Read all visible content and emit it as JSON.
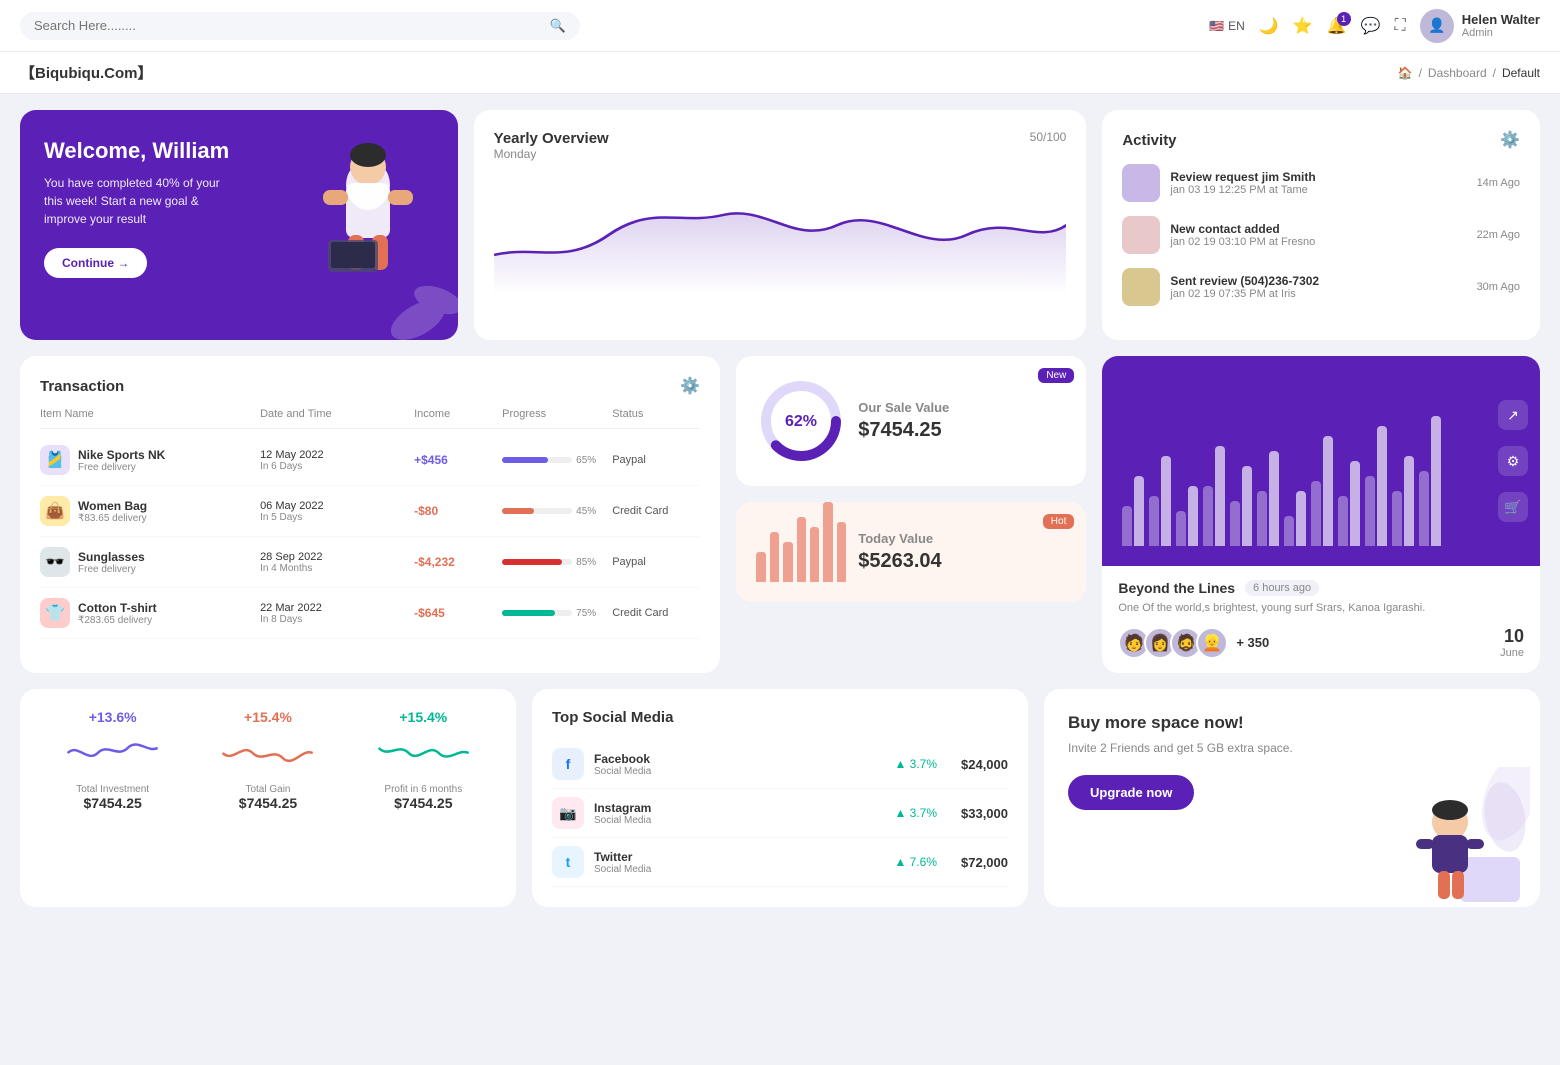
{
  "topnav": {
    "search_placeholder": "Search Here........",
    "lang": "EN",
    "notif_count": "1",
    "user_name": "Helen Walter",
    "user_role": "Admin"
  },
  "breadcrumb": {
    "site_title": "【Biqubiqu.Com】",
    "home": "🏠",
    "separator": "/",
    "dashboard": "Dashboard",
    "current": "Default"
  },
  "welcome": {
    "title": "Welcome, William",
    "subtitle": "You have completed 40% of your this week! Start a new goal & improve your result",
    "button": "Continue →"
  },
  "yearly_overview": {
    "title": "Yearly Overview",
    "day": "Monday",
    "score": "50/100"
  },
  "activity": {
    "title": "Activity",
    "items": [
      {
        "title": "Review request jim Smith",
        "sub": "jan 03 19 12:25 PM at Tame",
        "time": "14m Ago"
      },
      {
        "title": "New contact added",
        "sub": "jan 02 19 03:10 PM at Fresno",
        "time": "22m Ago"
      },
      {
        "title": "Sent review (504)236-7302",
        "sub": "jan 02 19 07:35 PM at Iris",
        "time": "30m Ago"
      }
    ]
  },
  "transaction": {
    "title": "Transaction",
    "headers": [
      "Item Name",
      "Date and Time",
      "Income",
      "Progress",
      "Status"
    ],
    "rows": [
      {
        "icon": "🎽",
        "icon_bg": "#e8e0f8",
        "name": "Nike Sports NK",
        "sub": "Free delivery",
        "date": "12 May 2022",
        "date_sub": "In 6 Days",
        "income": "+$456",
        "income_type": "pos",
        "progress": 65,
        "progress_color": "#6c5ce7",
        "status": "Paypal"
      },
      {
        "icon": "👜",
        "icon_bg": "#ffeaa7",
        "name": "Women Bag",
        "sub": "₹83.65 delivery",
        "date": "06 May 2022",
        "date_sub": "In 5 Days",
        "income": "-$80",
        "income_type": "neg",
        "progress": 45,
        "progress_color": "#e17055",
        "status": "Credit Card"
      },
      {
        "icon": "🕶️",
        "icon_bg": "#dfe6e9",
        "name": "Sunglasses",
        "sub": "Free delivery",
        "date": "28 Sep 2022",
        "date_sub": "In 4 Months",
        "income": "-$4,232",
        "income_type": "neg",
        "progress": 85,
        "progress_color": "#d63031",
        "status": "Paypal"
      },
      {
        "icon": "👕",
        "icon_bg": "#ffcccc",
        "name": "Cotton T-shirt",
        "sub": "₹283.65 delivery",
        "date": "22 Mar 2022",
        "date_sub": "In 8 Days",
        "income": "-$645",
        "income_type": "neg",
        "progress": 75,
        "progress_color": "#00b894",
        "status": "Credit Card"
      }
    ]
  },
  "sale_value": {
    "badge": "New",
    "percent": "62%",
    "label": "Our Sale Value",
    "value": "$7454.25"
  },
  "today_value": {
    "badge": "Hot",
    "label": "Today Value",
    "value": "$5263.04",
    "bars": [
      30,
      50,
      40,
      65,
      55,
      80,
      60
    ]
  },
  "beyond": {
    "title": "Beyond the Lines",
    "time": "6 hours ago",
    "desc": "One Of the world,s brightest, young surf Srars, Kanoa Igarashi.",
    "plus_count": "+ 350",
    "date_num": "10",
    "date_month": "June"
  },
  "stats": {
    "items": [
      {
        "percent": "+13.6%",
        "color": "#6c5ce7",
        "label": "Total Investment",
        "value": "$7454.25"
      },
      {
        "percent": "+15.4%",
        "color": "#e17055",
        "label": "Total Gain",
        "value": "$7454.25"
      },
      {
        "percent": "+15.4%",
        "color": "#00b894",
        "label": "Profit in 6 months",
        "value": "$7454.25"
      }
    ]
  },
  "social_media": {
    "title": "Top Social Media",
    "items": [
      {
        "icon": "f",
        "icon_bg": "#e8f0fe",
        "icon_color": "#1877f2",
        "name": "Facebook",
        "type": "Social Media",
        "growth": "3.7%",
        "amount": "$24,000"
      },
      {
        "icon": "📷",
        "icon_bg": "#ffe8f0",
        "icon_color": "#e1306c",
        "name": "Instagram",
        "type": "Social Media",
        "growth": "3.7%",
        "amount": "$33,000"
      },
      {
        "icon": "t",
        "icon_bg": "#e8f5fe",
        "icon_color": "#1da1f2",
        "name": "Twitter",
        "type": "Social Media",
        "growth": "7.6%",
        "amount": "$72,000"
      }
    ]
  },
  "buyspace": {
    "title": "Buy more space now!",
    "desc": "Invite 2 Friends and get 5 GB extra space.",
    "button": "Upgrade now"
  }
}
